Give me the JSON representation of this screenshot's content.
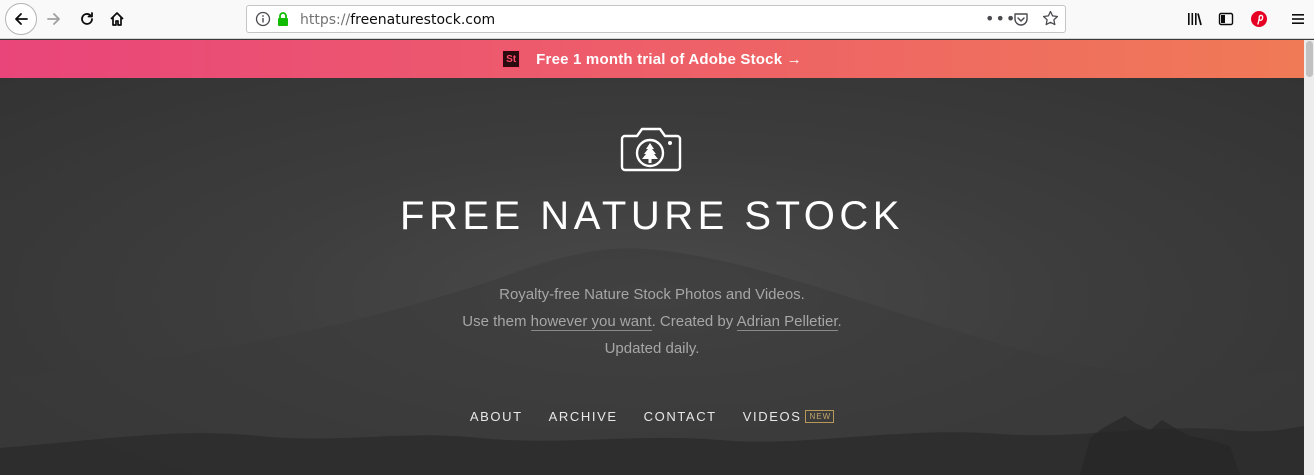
{
  "browser": {
    "url_prefix": "https://",
    "url_domain": "freenaturestock.com",
    "url_more": "•••",
    "icons": [
      "back-arrow-icon",
      "forward-arrow-icon",
      "reload-icon",
      "home-icon",
      "info-icon",
      "lock-icon",
      "pocket-icon",
      "bookmark-star-icon",
      "library-icon",
      "sidebar-icon",
      "pinterest-icon",
      "hamburger-menu-icon"
    ]
  },
  "promo": {
    "logo_text": "St",
    "text": "Free 1 month trial of Adobe Stock →"
  },
  "hero": {
    "title": "FREE NATURE STOCK",
    "tagline_line1": "Royalty-free Nature Stock Photos and Videos.",
    "tagline_use": "Use them ",
    "tagline_link1": "however you want",
    "tagline_created": ". Created by ",
    "tagline_link2": "Adrian Pelletier",
    "tagline_end": ".",
    "tagline_line3": "Updated daily."
  },
  "nav": {
    "items": [
      {
        "label": "ABOUT"
      },
      {
        "label": "ARCHIVE"
      },
      {
        "label": "CONTACT"
      },
      {
        "label": "VIDEOS"
      }
    ],
    "badge": "NEW"
  },
  "colors": {
    "promo_start": "#e9457a",
    "promo_end": "#f07a56",
    "hero_bg": "#3d3d3d",
    "badge": "#c6a66a"
  }
}
